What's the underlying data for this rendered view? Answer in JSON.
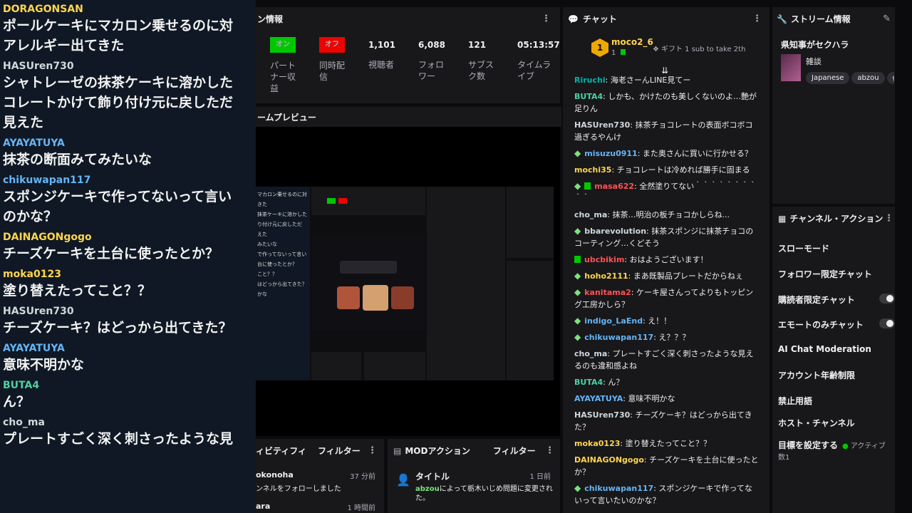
{
  "overlay": {
    "items": [
      {
        "user": "DORAGONSAN",
        "color": "#ffd54f",
        "lines": [
          "ポールケーキにマカロン乗せるのに対",
          "アレルギー出てきた"
        ]
      },
      {
        "user": "HASUren730",
        "color": "#cfd8dc",
        "lines": [
          "シャトレーゼの抹茶ケーキに溶かした",
          "コレートかけて飾り付け元に戻しただ",
          "見えた"
        ]
      },
      {
        "user": "AYAYATUYA",
        "color": "#64b5f6",
        "lines": [
          "抹茶の断面みてみたいな"
        ]
      },
      {
        "user": "chikuwapan117",
        "color": "#64b5f6",
        "lines": [
          "スポンジケーキで作ってないって言い",
          "のかな？"
        ]
      },
      {
        "user": "DAINAGONgogo",
        "color": "#ffd54f",
        "lines": [
          "チーズケーキを土台に使ったとか？"
        ]
      },
      {
        "user": "moka0123",
        "color": "#ffd54f",
        "lines": [
          "塗り替えたってこと？？"
        ]
      },
      {
        "user": "HASUren730",
        "color": "#cfd8dc",
        "lines": [
          "チーズケーキ？はどっから出てきた？"
        ]
      },
      {
        "user": "AYAYATUYA",
        "color": "#64b5f6",
        "lines": [
          "意味不明かな"
        ]
      },
      {
        "user": "BUTA4",
        "color": "#4dd0a0",
        "lines": [
          "ん？"
        ]
      },
      {
        "user": "cho_ma",
        "color": "#cfd8dc",
        "lines": [
          "プレートすごく深く刺さったような見"
        ]
      }
    ]
  },
  "stats": {
    "title": "ン情報",
    "partner_badge": "オン",
    "partner_label_1": "パート",
    "partner_label_2": "ナー収",
    "partner_label_3": "益",
    "simul_badge": "オフ",
    "simul_label_1": "同時配",
    "simul_label_2": "信",
    "viewers": "1,101",
    "viewers_label": "視聴者",
    "followers": "6,088",
    "followers_label_1": "フォロ",
    "followers_label_2": "ワー",
    "subs": "121",
    "subs_label_1": "サブス",
    "subs_label_2": "ク数",
    "time": "05:13:57",
    "time_label_1": "タイムラ",
    "time_label_2": "イブ",
    "colors": {
      "on": "#00c800",
      "off": "#eb0400"
    }
  },
  "preview": {
    "title": "ームプレビュー",
    "mini_texts": [
      "マカロン乗せるのに対",
      "きた",
      "抹茶ケーキに溶かした",
      "り付け元に戻しただ",
      "えた",
      "みたいな",
      "で作ってないって言い",
      "台に使ったとか？",
      "こと？？",
      "はどっから出てきた？",
      "かな"
    ]
  },
  "activity": {
    "title": "ィビティフィ",
    "filter": "フィルター",
    "item1_user": "okonoha",
    "item1_time": "37 分前",
    "item1_text": "ンネルをフォローしました",
    "item2_user": "ara",
    "item2_time": "1 時間前"
  },
  "modact": {
    "title": "MODアクション",
    "filter": "フィルター",
    "item_title": "タイトル",
    "item_time": "1 日前",
    "item_user": "abzou",
    "item_text": "によって栃木いじめ問題に変更され",
    "item_text2": "た。"
  },
  "chat": {
    "title": "チャット",
    "gifter": "moco2_6",
    "gifter_count": "1",
    "gift_text": "ギフト 1 sub to take 2th",
    "rank": "1",
    "messages": [
      {
        "user": "Riruchi",
        "color": "#00b5ad",
        "badge": "",
        "text": ": 海老さーんLINE見てー"
      },
      {
        "user": "BUTA4",
        "color": "#4dd0a0",
        "badge": "",
        "text": ": しかも、かけたのも美しくないのよ…艶が足りん"
      },
      {
        "user": "HASUren730",
        "color": "#cfd8dc",
        "badge": "",
        "text": ": 抹茶チョコレートの表面ボコボコ過ぎるやんけ"
      },
      {
        "user": "misuzu0911",
        "color": "#64b5f6",
        "badge": "diamond",
        "text": ": また奥さんに買いに行かせる？"
      },
      {
        "user": "mochi35",
        "color": "#ffd54f",
        "badge": "",
        "text": ": チョコレートは冷めれば勝手に固まる"
      },
      {
        "user": "masa622",
        "color": "#ff5252",
        "badge": "both",
        "text": ": 全然塗りてない｀｀｀｀｀｀｀｀｀｀"
      },
      {
        "user": "cho_ma",
        "color": "#cfd8dc",
        "badge": "",
        "text": ": 抹茶…明治の板チョコかしらね..."
      },
      {
        "user": "bbarevolution",
        "color": "#cfd8dc",
        "badge": "diamond",
        "text": ": 抹茶スポンジに抹茶チョコのコーティング…くどそう"
      },
      {
        "user": "ubcbikim",
        "color": "#ff5252",
        "badge": "sub",
        "text": ": おはようございます！"
      },
      {
        "user": "hoho2111",
        "color": "#ffd54f",
        "badge": "diamond",
        "text": ": まあ既製品プレートだからねぇ"
      },
      {
        "user": "kanitama2",
        "color": "#ff5252",
        "badge": "diamond",
        "text": ": ケーキ屋さんってよりもトッピング工房かしら？"
      },
      {
        "user": "indigo_LaEnd",
        "color": "#64b5f6",
        "badge": "diamond",
        "text": ": え！！"
      },
      {
        "user": "chikuwapan117",
        "color": "#64b5f6",
        "badge": "diamond",
        "text": ": え？？？"
      },
      {
        "user": "cho_ma",
        "color": "#cfd8dc",
        "badge": "",
        "text": ": プレートすごく深く刺さったような見えるのも違和感よね"
      },
      {
        "user": "BUTA4",
        "color": "#4dd0a0",
        "badge": "",
        "text": ": ん？"
      },
      {
        "user": "AYAYATUYA",
        "color": "#64b5f6",
        "badge": "",
        "text": ": 意味不明かな"
      },
      {
        "user": "HASUren730",
        "color": "#cfd8dc",
        "badge": "",
        "text": ": チーズケーキ？はどっから出てきた？"
      },
      {
        "user": "moka0123",
        "color": "#ffd54f",
        "badge": "",
        "text": ": 塗り替えたってこと？？"
      },
      {
        "user": "DAINAGONgogo",
        "color": "#ffd54f",
        "badge": "",
        "text": ": チーズケーキを土台に使ったとか？"
      },
      {
        "user": "chikuwapan117",
        "color": "#64b5f6",
        "badge": "diamond",
        "text": ": スポンジケーキで作ってないって言いたいのかな？"
      }
    ]
  },
  "sinfo": {
    "title": "ストリーム情報",
    "stream_title": "県知事がセクハラ",
    "category": "雑談",
    "tags": [
      "Japanese",
      "abzou",
      "g"
    ]
  },
  "chanact": {
    "title": "チャンネル・アクション",
    "items": [
      "スローモード",
      "フォロワー限定チャット",
      "購読者限定チャット",
      "エモートのみチャット",
      "AI Chat Moderation",
      "アカウント年齢制限",
      "禁止用語",
      "ホスト・チャンネル",
      "目標を設定する"
    ],
    "goal_status": "アクティブ数1"
  }
}
